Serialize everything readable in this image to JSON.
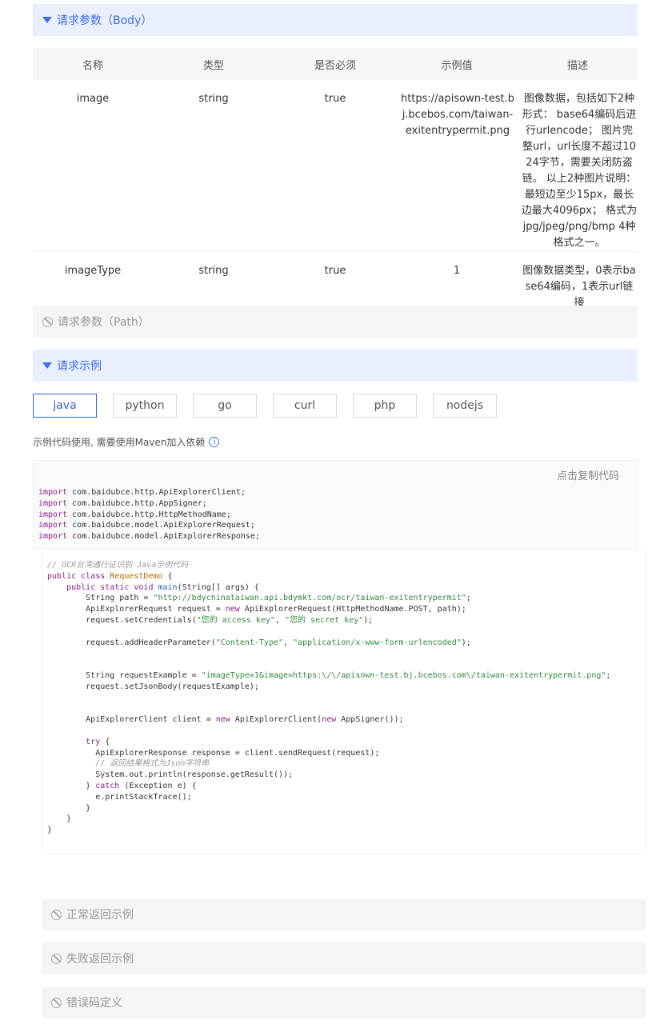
{
  "sections": {
    "body_params": "请求参数（Body）",
    "path_params": "请求参数（Path）",
    "request_example": "请求示例",
    "normal_response": "正常返回示例",
    "error_response": "失败返回示例",
    "error_codes": "错误码定义"
  },
  "table": {
    "headers": [
      "名称",
      "类型",
      "是否必须",
      "示例值",
      "描述"
    ],
    "rows": [
      {
        "name": "image",
        "type": "string",
        "required": "true",
        "example": "https://apisown-test.bj.bcebos.com/taiwan-exitentrypermit.png",
        "desc": "图像数据，包括如下2种形式： base64编码后进行urlencode； 图片完整url，url长度不超过1024字节，需要关闭防盗链。 以上2种图片说明： 最短边至少15px，最长边最大4096px； 格式为 jpg/jpeg/png/bmp 4种格式之一。"
      },
      {
        "name": "imageType",
        "type": "string",
        "required": "true",
        "example": "1",
        "desc": "图像数据类型，0表示base64编码，1表示url链接"
      }
    ]
  },
  "lang_tabs": [
    "java",
    "python",
    "go",
    "curl",
    "php",
    "nodejs"
  ],
  "active_lang": "java",
  "hint": "示例代码使用, 需要使用Maven加入依赖",
  "copy_label": "点击复制代码",
  "code": {
    "imports": [
      "com.baidubce.http.ApiExplorerClient;",
      "com.baidubce.http.AppSigner;",
      "com.baidubce.http.HttpMethodName;",
      "com.baidubce.model.ApiExplorerRequest;",
      "com.baidubce.model.ApiExplorerResponse;"
    ],
    "comment_title": "// OCR台湾通行证识别 Java示例代码",
    "class_name": "RequestDemo",
    "url": "\"http://bdychinataiwan.api.bdymkt.com/ocr/taiwan-exitentrypermit\"",
    "access_key": "\"您的 access key\"",
    "secret_key": "\"您的 secret key\"",
    "header_name": "\"Content-Type\"",
    "header_value": "\"application/x-www-form-urlencoded\"",
    "request_example": "\"imageType=1&image=https:\\/\\/apisown-test.bj.bcebos.com\\/taiwan-exitentrypermit.png\"",
    "comment_result": "// 返回结果格式为Json字符串"
  },
  "colors": {
    "accent": "#3c6ee6",
    "active_section_bg": "#e9effd",
    "disabled_section_bg": "#f5f5f5",
    "keyword": "#8a1e8a",
    "string": "#2f8a3a"
  }
}
